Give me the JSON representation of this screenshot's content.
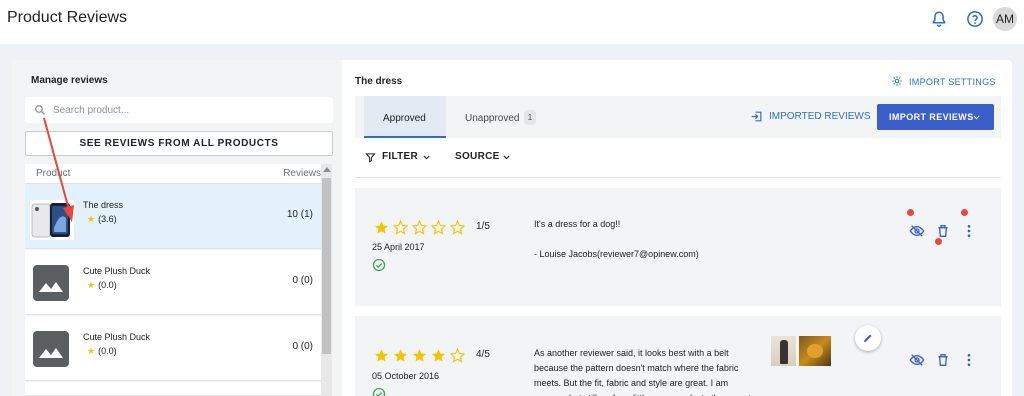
{
  "header": {
    "title": "Product Reviews",
    "bell_icon": "bell-icon",
    "help_icon": "help-circle-icon",
    "avatar_initials": "AM"
  },
  "left_panel": {
    "heading": "Manage reviews",
    "search_placeholder": "Search product...",
    "all_products_button": "SEE REVIEWS FROM ALL PRODUCTS",
    "columns": {
      "product": "Product",
      "reviews": "Reviews"
    },
    "products": [
      {
        "name": "The dress",
        "rating": "(3.6)",
        "reviews": "10  (1)",
        "selected": true,
        "image": "phone-photo"
      },
      {
        "name": "Cute Plush Duck",
        "rating": "(0.0)",
        "reviews": "0  (0)",
        "selected": false,
        "image": "image-placeholder-icon"
      },
      {
        "name": "Cute Plush Duck",
        "rating": "(0.0)",
        "reviews": "0  (0)",
        "selected": false,
        "image": "image-placeholder-icon"
      }
    ]
  },
  "right_panel": {
    "product_title": "The dress",
    "import_settings": "IMPORT SETTINGS",
    "tabs": [
      {
        "label": "Approved",
        "active": true
      },
      {
        "label": "Unapproved",
        "count": "1",
        "active": false
      }
    ],
    "imported_reviews": "IMPORTED REVIEWS",
    "import_reviews_button": "IMPORT REVIEWS",
    "filter_label": "FILTER",
    "source_label": "SOURCE",
    "reviews": [
      {
        "stars": 1,
        "score": "1/5",
        "date": "25 April 2017",
        "verified": true,
        "text": "It's a dress for a dog!!\n\n- Louise Jacobs(reviewer7@opinew.com)",
        "has_images": false
      },
      {
        "stars": 4,
        "score": "4/5",
        "date": "05 October 2016",
        "verified": true,
        "text": "As another reviewer said, it looks best with a belt\nbecause the pattern doesn't match where the fabric\nmeets. But the fit, fabric and style are great. I am\nyounger but still prefer a little more modesty than most",
        "has_images": true
      }
    ]
  },
  "colors": {
    "accent": "#2c6ecb",
    "button": "#3c5ec9",
    "star": "#f5c400",
    "verified": "#3ca55c",
    "annotation": "#e8473b"
  }
}
